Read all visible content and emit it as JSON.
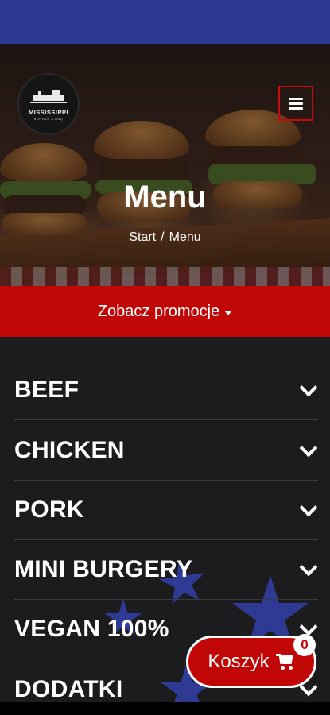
{
  "brand": {
    "logo_name": "MISSISSIPPI",
    "logo_sub": "BURGER & BBQ"
  },
  "header": {
    "title": "Menu",
    "breadcrumb": {
      "home": "Start",
      "separator": "/",
      "current": "Menu"
    },
    "menu_icon": "hamburger-icon"
  },
  "promo": {
    "label": "Zobacz promocje",
    "icon": "caret-down-icon"
  },
  "categories": [
    {
      "label": "BEEF",
      "icon": "chevron-down-icon"
    },
    {
      "label": "CHICKEN",
      "icon": "chevron-down-icon"
    },
    {
      "label": "PORK",
      "icon": "chevron-down-icon"
    },
    {
      "label": "MINI BURGERY",
      "icon": "chevron-down-icon"
    },
    {
      "label": "VEGAN 100%",
      "icon": "chevron-down-icon"
    },
    {
      "label": "DODATKI",
      "icon": "chevron-down-icon"
    }
  ],
  "cart": {
    "label": "Koszyk",
    "count": "0",
    "icon": "cart-icon"
  },
  "colors": {
    "topbar": "#2d3a93",
    "accent_red": "#c10606",
    "background": "#1c1c1e",
    "star_blue": "#2e3a94"
  }
}
